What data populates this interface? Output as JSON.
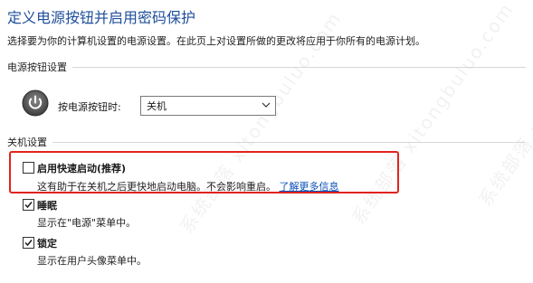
{
  "page": {
    "title": "定义电源按钮并启用密码保护",
    "description": "选择要为你的计算机设置的电源设置。在此页上对设置所做的更改将应用于你所有的电源计划。"
  },
  "power_button_section": {
    "heading": "电源按钮设置",
    "label": "按电源按钮时:",
    "selected_value": "关机",
    "icon": "power-icon"
  },
  "shutdown_section": {
    "heading": "关机设置",
    "options": [
      {
        "label": "启用快速启动(推荐)",
        "description": "这有助于在关机之后更快地启动电脑。不会影响重启。",
        "link": "了解更多信息",
        "checked": false
      },
      {
        "label": "睡眠",
        "description": "显示在\"电源\"菜单中。",
        "checked": true
      },
      {
        "label": "锁定",
        "description": "显示在用户头像菜单中。",
        "checked": true
      }
    ]
  },
  "watermark": "系统部落 xitongbuluo.com",
  "colors": {
    "title": "#1f4e9c",
    "link": "#0a4fb7",
    "highlight": "#e0241d"
  }
}
